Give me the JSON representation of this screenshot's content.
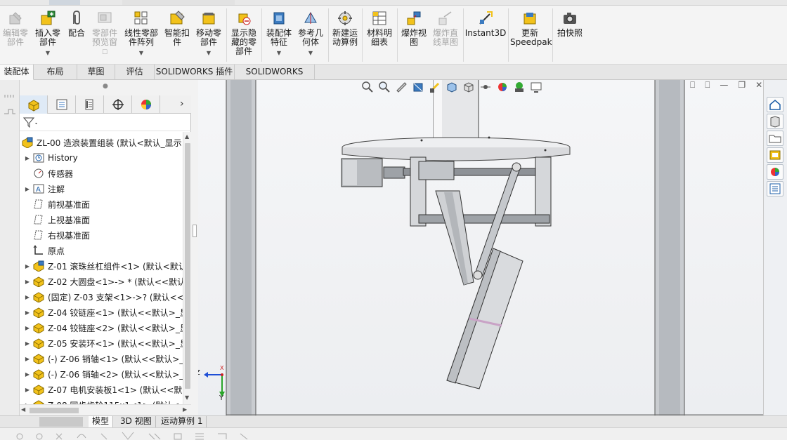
{
  "ribbon": {
    "buttons": [
      {
        "label": "编辑零部件",
        "disabled": true,
        "icon": "edit-component-icon"
      },
      {
        "label": "插入零部件",
        "disabled": false,
        "dropdown": true,
        "icon": "insert-component-icon"
      },
      {
        "label": "配合",
        "disabled": false,
        "icon": "mate-paperclip-icon"
      },
      {
        "label": "零部件预览窗",
        "disabled": true,
        "icon": "component-preview-icon"
      },
      {
        "label": "线性零部件阵列",
        "disabled": false,
        "dropdown": true,
        "icon": "linear-pattern-icon"
      },
      {
        "label": "智能扣件",
        "disabled": false,
        "icon": "smart-fasteners-icon"
      },
      {
        "label": "移动零部件",
        "disabled": false,
        "dropdown": true,
        "icon": "move-component-icon"
      },
      {
        "label": "显示隐藏的零部件",
        "disabled": false,
        "icon": "show-hidden-icon"
      },
      {
        "label": "装配体特征",
        "disabled": false,
        "dropdown": true,
        "icon": "assembly-features-icon"
      },
      {
        "label": "参考几何体",
        "disabled": false,
        "dropdown": true,
        "icon": "reference-geometry-icon"
      },
      {
        "label": "新建运动算例",
        "disabled": false,
        "icon": "new-motion-study-icon"
      },
      {
        "label": "材料明细表",
        "disabled": false,
        "icon": "bill-of-materials-icon"
      },
      {
        "label": "爆炸视图",
        "disabled": false,
        "icon": "exploded-view-icon"
      },
      {
        "label": "爆炸直线草图",
        "disabled": true,
        "icon": "explode-line-sketch-icon"
      },
      {
        "label": "Instant3D",
        "disabled": false,
        "icon": "instant3d-icon"
      },
      {
        "label": "更新Speedpak",
        "disabled": false,
        "icon": "update-speedpak-icon"
      },
      {
        "label": "拍快照",
        "disabled": false,
        "icon": "take-snapshot-icon"
      }
    ]
  },
  "tabs": [
    {
      "label": "装配体",
      "active": true
    },
    {
      "label": "布局"
    },
    {
      "label": "草图"
    },
    {
      "label": "评估"
    },
    {
      "label": "SOLIDWORKS 插件"
    },
    {
      "label": "SOLIDWORKS MBD"
    }
  ],
  "feature_manager": {
    "tabs": [
      "feature-manager-icon",
      "property-manager-icon",
      "configuration-manager-icon",
      "dimxpert-icon",
      "display-manager-icon"
    ],
    "root": "ZL-00 造浪装置组装  (默认<默认_显示",
    "items": [
      {
        "label": "History",
        "icon": "history-icon",
        "expandable": true
      },
      {
        "label": "传感器",
        "icon": "sensor-icon",
        "expandable": false
      },
      {
        "label": "注解",
        "icon": "annotation-icon",
        "expandable": true
      },
      {
        "label": "前视基准面",
        "icon": "plane-icon",
        "expandable": false
      },
      {
        "label": "上视基准面",
        "icon": "plane-icon",
        "expandable": false
      },
      {
        "label": "右视基准面",
        "icon": "plane-icon",
        "expandable": false
      },
      {
        "label": "原点",
        "icon": "origin-icon",
        "expandable": false
      },
      {
        "label": "Z-01 滚珠丝杠组件<1> (默认<默认",
        "icon": "subassembly-icon",
        "expandable": true
      },
      {
        "label": "Z-02 大圆盘<1>-> * (默认<<默认",
        "icon": "part-icon",
        "expandable": true
      },
      {
        "label": "(固定) Z-03 支架<1>->? (默认<<",
        "icon": "part-icon",
        "expandable": true
      },
      {
        "label": "Z-04 铰链座<1> (默认<<默认>_显",
        "icon": "part-icon",
        "expandable": true
      },
      {
        "label": "Z-04 铰链座<2> (默认<<默认>_显",
        "icon": "part-icon",
        "expandable": true
      },
      {
        "label": "Z-05 安装环<1> (默认<<默认>_显",
        "icon": "part-icon",
        "expandable": true
      },
      {
        "label": "(-) Z-06 销轴<1> (默认<<默认>_",
        "icon": "part-icon",
        "expandable": true
      },
      {
        "label": "(-) Z-06 销轴<2> (默认<<默认>_",
        "icon": "part-icon",
        "expandable": true
      },
      {
        "label": "Z-07 电机安装板1<1> (默认<<默",
        "icon": "part-icon",
        "expandable": true
      },
      {
        "label": "Z-08 同步齿轮115x1<1> (默认<",
        "icon": "part-icon",
        "expandable": true
      }
    ]
  },
  "bottom_tabs": [
    {
      "label": "模型",
      "active": true
    },
    {
      "label": "3D 视图"
    },
    {
      "label": "运动算例 1"
    }
  ],
  "triad": {
    "z": "Z",
    "y": "Y",
    "x": "X"
  },
  "colors": {
    "accent": "#1e5fa8",
    "part_yellow": "#f2c21b",
    "frame_gray": "#b9bcc0",
    "pink_edge": "#c9a3c6"
  }
}
